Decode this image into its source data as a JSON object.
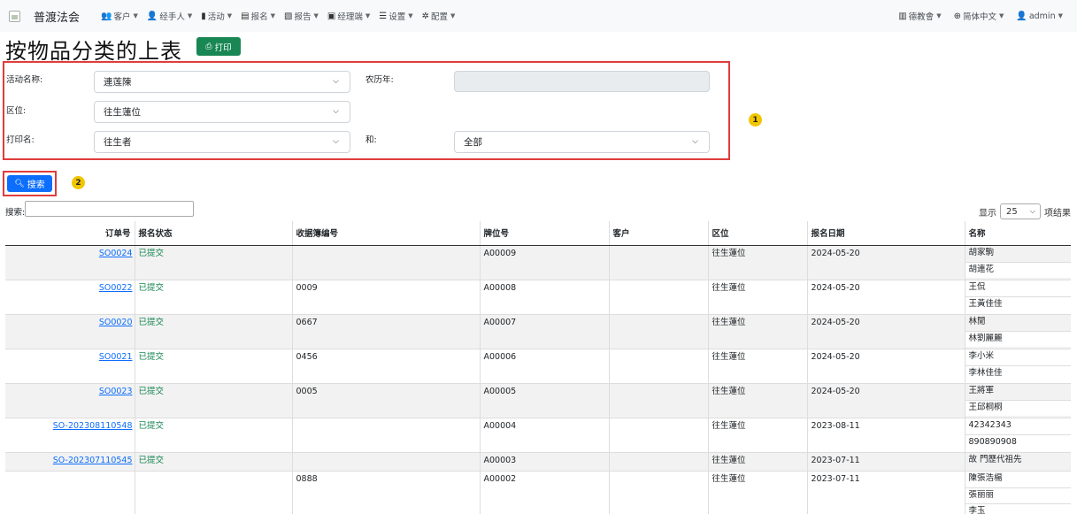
{
  "navbar": {
    "brand": "普渡法会",
    "menu": [
      {
        "icon": "users-icon",
        "glyph": "👥",
        "label": "客户"
      },
      {
        "icon": "user-tie-icon",
        "glyph": "👤",
        "label": "经手人"
      },
      {
        "icon": "activity-icon",
        "glyph": "▮",
        "label": "活动"
      },
      {
        "icon": "register-icon",
        "glyph": "▤",
        "label": "报名"
      },
      {
        "icon": "report-icon",
        "glyph": "▧",
        "label": "报告"
      },
      {
        "icon": "manager-icon",
        "glyph": "▣",
        "label": "经理端"
      },
      {
        "icon": "settings-list-icon",
        "glyph": "☰",
        "label": "设置"
      },
      {
        "icon": "config-gear-icon",
        "glyph": "✲",
        "label": "配置"
      }
    ],
    "right": [
      {
        "icon": "org-icon",
        "glyph": "▥",
        "label": "德教會"
      },
      {
        "icon": "globe-icon",
        "glyph": "⊕",
        "label": "简体中文"
      },
      {
        "icon": "user-icon",
        "glyph": "👤",
        "label": "admin"
      }
    ]
  },
  "page": {
    "title": "按物品分类的上表",
    "print_label": "打印"
  },
  "filters": {
    "activity_label": "活动名称:",
    "activity_value": "連莲陳",
    "lunar_year_label": "农历年:",
    "zone_label": "区位:",
    "zone_value": "往生蓮位",
    "print_name_label": "打印名:",
    "print_name_value": "往生者",
    "and_label": "和:",
    "and_value": "全部"
  },
  "annotations": {
    "one": "1",
    "two": "2"
  },
  "search_button": "搜索",
  "table_controls": {
    "search_label": "搜索:",
    "show_label": "显示",
    "page_size": "25",
    "results_label": "项结果"
  },
  "table": {
    "headers": [
      "订单号",
      "报名状态",
      "收据簿编号",
      "牌位号",
      "客户",
      "区位",
      "报名日期",
      "名称"
    ],
    "rows": [
      {
        "order": "SO0024",
        "status": "已提交",
        "receipt": "",
        "tablet": "A00009",
        "customer": "",
        "zone": "往生蓮位",
        "date": "2024-05-20",
        "names": [
          "胡家駒",
          "胡連花"
        ]
      },
      {
        "order": "SO0022",
        "status": "已提交",
        "receipt": "0009",
        "tablet": "A00008",
        "customer": "",
        "zone": "往生蓮位",
        "date": "2024-05-20",
        "names": [
          "王侃",
          "王黃佳佳"
        ]
      },
      {
        "order": "SO0020",
        "status": "已提交",
        "receipt": "0667",
        "tablet": "A00007",
        "customer": "",
        "zone": "往生蓮位",
        "date": "2024-05-20",
        "names": [
          "林閒",
          "林劉麗麗"
        ]
      },
      {
        "order": "SO0021",
        "status": "已提交",
        "receipt": "0456",
        "tablet": "A00006",
        "customer": "",
        "zone": "往生蓮位",
        "date": "2024-05-20",
        "names": [
          "李小米",
          "李林佳佳"
        ]
      },
      {
        "order": "SO0023",
        "status": "已提交",
        "receipt": "0005",
        "tablet": "A00005",
        "customer": "",
        "zone": "往生蓮位",
        "date": "2024-05-20",
        "names": [
          "王將軍",
          "王邱桐桐"
        ]
      },
      {
        "order": "SO-202308110548",
        "status": "已提交",
        "receipt": "",
        "tablet": "A00004",
        "customer": "",
        "zone": "往生蓮位",
        "date": "2023-08-11",
        "names": [
          "42342343",
          "890890908"
        ]
      },
      {
        "order": "SO-202307110545",
        "status": "已提交",
        "receipt": "",
        "tablet": "A00003",
        "customer": "",
        "zone": "往生蓮位",
        "date": "2023-07-11",
        "names": [
          "故 門歷代祖先"
        ]
      },
      {
        "order": "",
        "status": "",
        "receipt": "0888",
        "tablet": "A00002",
        "customer": "",
        "zone": "往生蓮位",
        "date": "2023-07-11",
        "names": [
          "陳張浩楊",
          "張丽丽",
          "李玉"
        ]
      }
    ]
  }
}
